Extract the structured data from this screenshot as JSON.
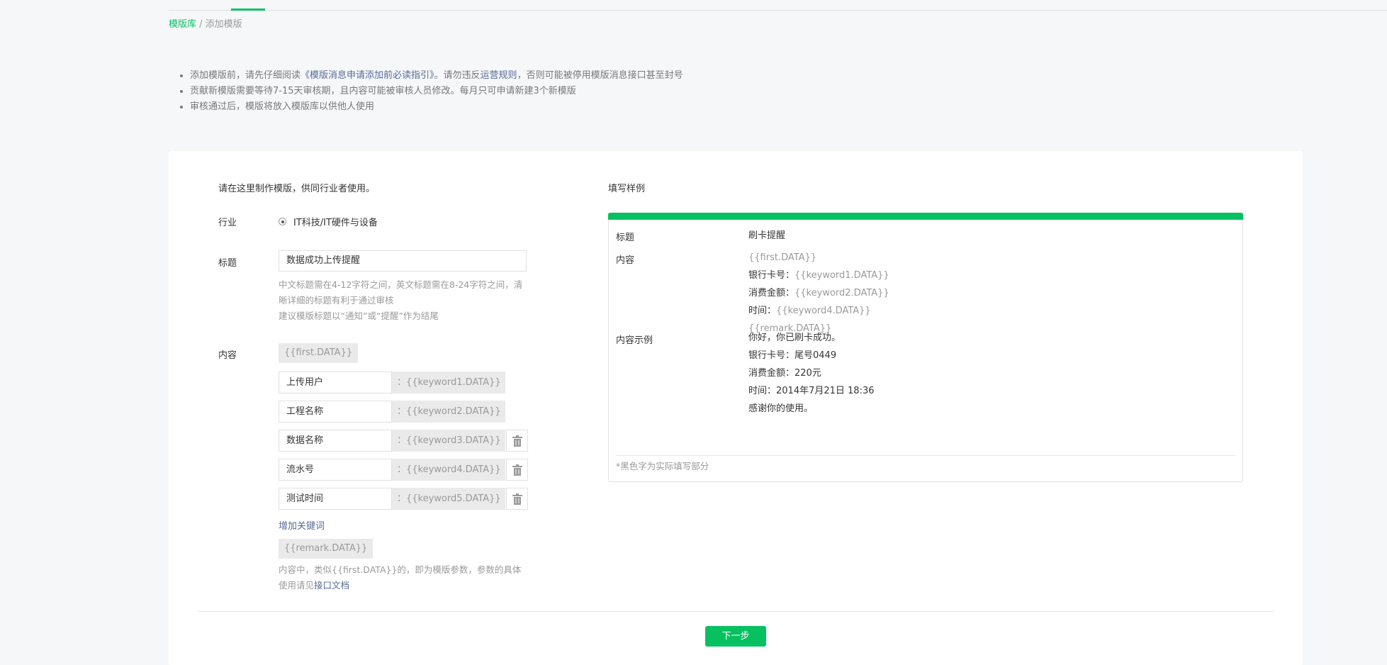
{
  "breadcrumb": {
    "root": "模版库",
    "separator": " / ",
    "current": "添加模版"
  },
  "notice": {
    "item1_prefix": "添加模版前，请先仔细阅读",
    "item1_link1": "《模版消息申请添加前必读指引》",
    "item1_middle": "。请勿违反",
    "item1_link2": "运营规则",
    "item1_suffix": "，否则可能被停用模版消息接口甚至封号",
    "item2": "贡献新模版需要等待7-15天审核期，且内容可能被审核人员修改。每月只可申请新建3个新模版",
    "item3": "审核通过后，模版将放入模版库以供他人使用"
  },
  "form": {
    "intro": "请在这里制作模版，供同行业者使用。",
    "industry_label": "行业",
    "industry_value": "IT科技/IT硬件与设备",
    "title_label": "标题",
    "title_value": "数据成功上传提醒",
    "title_hint1": "中文标题需在4-12字符之间，英文标题需在8-24字符之间，清晰详细的标题有利于通过审核",
    "title_hint2": "建议模版标题以“通知”或“提醒”作为结尾",
    "content_label": "内容",
    "first_tag": "{{first.DATA}}",
    "keywords": [
      {
        "name": "上传用户",
        "var": "：{{keyword1.DATA}}"
      },
      {
        "name": "工程名称",
        "var": "：{{keyword2.DATA}}"
      },
      {
        "name": "数据名称",
        "var": "：{{keyword3.DATA}}"
      },
      {
        "name": "流水号",
        "var": "：{{keyword4.DATA}}"
      },
      {
        "name": "测试时间",
        "var": "：{{keyword5.DATA}}"
      }
    ],
    "add_keyword": "增加关键词",
    "remark_tag": "{{remark.DATA}}",
    "foot_hint_prefix": "内容中，类似{{first.DATA}}的，即为模版参数，参数的具体使用请见",
    "foot_hint_link": "接口文档"
  },
  "example": {
    "heading": "填写样例",
    "title_label": "标题",
    "title_value": "刷卡提醒",
    "content_label": "内容",
    "content_first": "{{first.DATA}}",
    "content_l1_label": "银行卡号：",
    "content_l1_var": "{{keyword1.DATA}}",
    "content_l2_label": "消费金额：",
    "content_l2_var": "{{keyword2.DATA}}",
    "content_l3_label": "时间：",
    "content_l3_var": "{{keyword4.DATA}}",
    "content_remark": "{{remark.DATA}}",
    "sample_label": "内容示例",
    "sample_lines": [
      "你好，你已刷卡成功。",
      "银行卡号：尾号0449",
      "消费金额：220元",
      "时间：2014年7月21日 18:36",
      "感谢你的使用。"
    ],
    "note": "*黑色字为实际填写部分"
  },
  "next_button": "下一步",
  "colors": {
    "accent": "#07c160",
    "link": "#576b95",
    "muted": "#9a9a9a"
  },
  "icons": {
    "delete": "trash-icon",
    "radio": "radio-checked-icon"
  }
}
